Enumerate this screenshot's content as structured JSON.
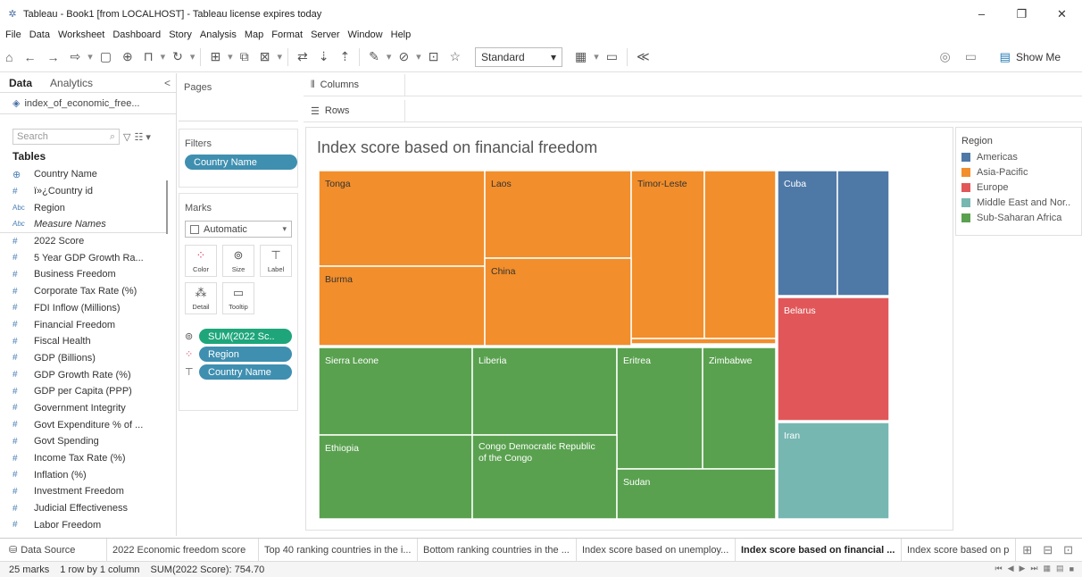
{
  "window": {
    "title": "Tableau - Book1 [from LOCALHOST] - Tableau license expires today",
    "min": "–",
    "max": "❐",
    "close": "✕"
  },
  "menu": [
    "File",
    "Data",
    "Worksheet",
    "Dashboard",
    "Story",
    "Analysis",
    "Map",
    "Format",
    "Server",
    "Window",
    "Help"
  ],
  "toolbar": {
    "fit_select": "Standard",
    "show_me": "Show Me"
  },
  "data_pane": {
    "tab_data": "Data",
    "tab_analytics": "Analytics",
    "collapse": "<",
    "datasource": "index_of_economic_free...",
    "search_placeholder": "Search",
    "tables_label": "Tables",
    "fields": [
      {
        "icon": "globe",
        "name": "Country Name"
      },
      {
        "icon": "#",
        "name": "ï»¿Country id"
      },
      {
        "icon": "Abc",
        "name": "Region"
      },
      {
        "icon": "Abc",
        "name": "Measure Names",
        "italic": true
      },
      {
        "icon": "#",
        "name": "2022 Score"
      },
      {
        "icon": "#",
        "name": "5 Year GDP Growth Ra..."
      },
      {
        "icon": "#",
        "name": "Business Freedom"
      },
      {
        "icon": "#",
        "name": "Corporate Tax Rate (%)"
      },
      {
        "icon": "#",
        "name": "FDI Inflow (Millions)"
      },
      {
        "icon": "#",
        "name": "Financial Freedom"
      },
      {
        "icon": "#",
        "name": "Fiscal Health"
      },
      {
        "icon": "#",
        "name": "GDP (Billions)"
      },
      {
        "icon": "#",
        "name": "GDP Growth Rate (%)"
      },
      {
        "icon": "#",
        "name": "GDP per Capita (PPP)"
      },
      {
        "icon": "#",
        "name": "Government Integrity"
      },
      {
        "icon": "#",
        "name": "Govt Expenditure % of ..."
      },
      {
        "icon": "#",
        "name": "Govt Spending"
      },
      {
        "icon": "#",
        "name": "Income Tax Rate (%)"
      },
      {
        "icon": "#",
        "name": "Inflation (%)"
      },
      {
        "icon": "#",
        "name": "Investment Freedom"
      },
      {
        "icon": "#",
        "name": "Judicial Effectiveness"
      },
      {
        "icon": "#",
        "name": "Labor Freedom"
      }
    ]
  },
  "cards": {
    "pages": "Pages",
    "filters": "Filters",
    "filter_pill": "Country Name",
    "marks": "Marks",
    "mark_type": "Automatic",
    "btn_color": "Color",
    "btn_size": "Size",
    "btn_label": "Label",
    "btn_detail": "Detail",
    "btn_tooltip": "Tooltip",
    "mark_size_pill": "SUM(2022 Sc..",
    "mark_color_pill": "Region",
    "mark_label_pill": "Country Name"
  },
  "shelves": {
    "columns": "Columns",
    "rows": "Rows"
  },
  "viz": {
    "title": "Index score based on financial freedom"
  },
  "legend": {
    "title": "Region",
    "items": [
      {
        "name": "Americas",
        "color": "#4e79a7"
      },
      {
        "name": "Asia-Pacific",
        "color": "#f28e2b"
      },
      {
        "name": "Europe",
        "color": "#e15759"
      },
      {
        "name": "Middle East and Nor..",
        "color": "#76b7b2"
      },
      {
        "name": "Sub-Saharan Africa",
        "color": "#59a14f"
      }
    ]
  },
  "sheet_tabs": {
    "datasource": "Data Source",
    "tabs": [
      "2022 Economic freedom score",
      "Top 40 ranking countries in the i...",
      "Bottom ranking countries in the ...",
      "Index score based on unemploy...",
      "Index score based on financial ...",
      "Index score based on p"
    ],
    "active_index": 4
  },
  "status": {
    "marks": "25 marks",
    "rows_cols": "1 row by 1 column",
    "sum": "SUM(2022 Score): 754.70"
  },
  "chart_data": {
    "type": "treemap",
    "title": "Index score based on financial freedom",
    "size_measure": "SUM(2022 Score)",
    "color_dimension": "Region",
    "label_dimension": "Country Name",
    "labeled_nodes": [
      {
        "label": "Tonga",
        "region": "Asia-Pacific"
      },
      {
        "label": "Laos",
        "region": "Asia-Pacific"
      },
      {
        "label": "Timor-Leste",
        "region": "Asia-Pacific"
      },
      {
        "label": "Burma",
        "region": "Asia-Pacific"
      },
      {
        "label": "China",
        "region": "Asia-Pacific"
      },
      {
        "label": "Cuba",
        "region": "Americas"
      },
      {
        "label": "Belarus",
        "region": "Europe"
      },
      {
        "label": "Iran",
        "region": "Middle East and Nor.."
      },
      {
        "label": "Sierra Leone",
        "region": "Sub-Saharan Africa"
      },
      {
        "label": "Liberia",
        "region": "Sub-Saharan Africa"
      },
      {
        "label": "Eritrea",
        "region": "Sub-Saharan Africa"
      },
      {
        "label": "Zimbabwe",
        "region": "Sub-Saharan Africa"
      },
      {
        "label": "Ethiopia",
        "region": "Sub-Saharan Africa"
      },
      {
        "label": "Congo Democratic Republic of the Congo",
        "region": "Sub-Saharan Africa"
      },
      {
        "label": "Sudan",
        "region": "Sub-Saharan Africa"
      }
    ],
    "total_marks": 25,
    "total": 754.7
  }
}
